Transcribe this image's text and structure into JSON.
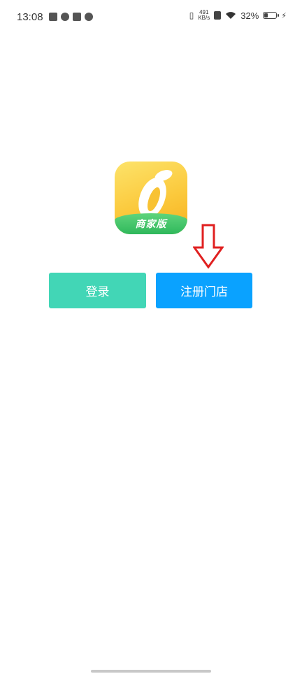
{
  "status_bar": {
    "time": "13:08",
    "net_speed_value": "491",
    "net_speed_unit": "KB/s",
    "battery_percent": "32%",
    "battery_level": 0.32
  },
  "logo": {
    "band_text": "商家版"
  },
  "buttons": {
    "login_label": "登录",
    "register_label": "注册门店"
  },
  "colors": {
    "login_button": "#42d6b6",
    "register_button": "#0aa2ff",
    "arrow": "#e02020"
  }
}
